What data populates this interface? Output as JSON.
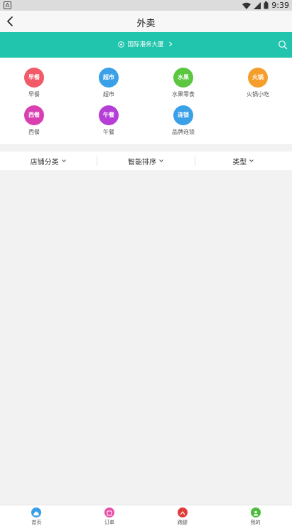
{
  "status_bar": {
    "time": "9:39",
    "left_badge": "A"
  },
  "header": {
    "title": "外卖"
  },
  "location_bar": {
    "address": "国际港务大厦"
  },
  "categories": [
    {
      "icon_text": "早餐",
      "label": "早餐",
      "color": "#f25a67"
    },
    {
      "icon_text": "超市",
      "label": "超市",
      "color": "#3aa0e8"
    },
    {
      "icon_text": "水果",
      "label": "水果零食",
      "color": "#5bc63f"
    },
    {
      "icon_text": "火锅",
      "label": "火锅小吃",
      "color": "#f59e2c"
    },
    {
      "icon_text": "西餐",
      "label": "西餐",
      "color": "#d93fb0"
    },
    {
      "icon_text": "午餐",
      "label": "午餐",
      "color": "#b43ed6"
    },
    {
      "icon_text": "连锁",
      "label": "品牌连锁",
      "color": "#3aa0e8"
    }
  ],
  "filters": [
    {
      "label": "店铺分类"
    },
    {
      "label": "智能排序"
    },
    {
      "label": "类型"
    }
  ],
  "tab_bar": [
    {
      "label": "首页",
      "color": "#3a9ee6",
      "icon": "home-icon"
    },
    {
      "label": "订单",
      "color": "#e84fa8",
      "icon": "order-icon"
    },
    {
      "label": "跑腿",
      "color": "#e03b3b",
      "icon": "errand-icon"
    },
    {
      "label": "我的",
      "color": "#4bbd3a",
      "icon": "profile-icon"
    }
  ],
  "colors": {
    "accent": "#21c4ad"
  }
}
